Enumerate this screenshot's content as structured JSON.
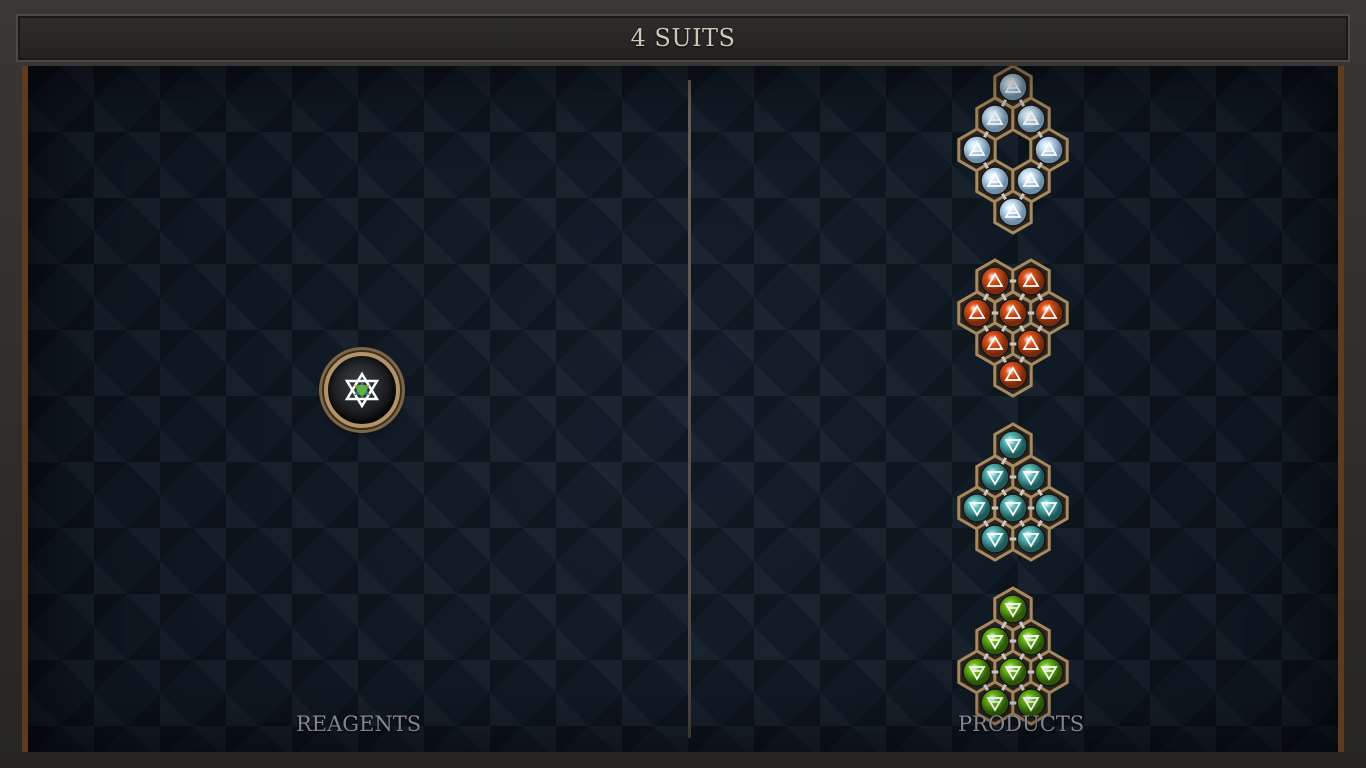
{
  "header": {
    "title": "4 SUITS"
  },
  "reagents": {
    "label": "REAGENTS",
    "items": [
      {
        "icon": "star-of-david-icon"
      }
    ]
  },
  "products": {
    "label": "PRODUCTS",
    "molecules": [
      {
        "name": "air",
        "color": "#cfe6f7",
        "rim": "#6f8ea8",
        "symbol": "air-triangle-icon"
      },
      {
        "name": "fire",
        "color": "#e0541d",
        "rim": "#7a2a0a",
        "symbol": "fire-triangle-icon"
      },
      {
        "name": "water",
        "color": "#5fbfbf",
        "rim": "#1f5a5a",
        "symbol": "water-triangle-icon"
      },
      {
        "name": "earth",
        "color": "#6fbf1a",
        "rim": "#2d5a08",
        "symbol": "earth-triangle-icon"
      }
    ]
  }
}
